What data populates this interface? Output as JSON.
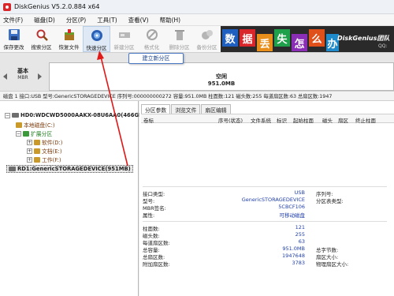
{
  "window": {
    "title": "DiskGenius V5.2.0.884 x64"
  },
  "menu": [
    "文件(F)",
    "磁盘(D)",
    "分区(P)",
    "工具(T)",
    "查看(V)",
    "帮助(H)"
  ],
  "toolbar": [
    {
      "label": "保存更改",
      "icon": "save-icon",
      "state": "normal"
    },
    {
      "label": "搜索分区",
      "icon": "magnifier-icon",
      "state": "normal"
    },
    {
      "label": "恢复文件",
      "icon": "recover-icon",
      "state": "normal"
    },
    {
      "label": "快速分区",
      "icon": "disc-icon",
      "state": "active"
    },
    {
      "label": "新建分区",
      "icon": "new-partition-icon",
      "state": "disabled"
    },
    {
      "label": "格式化",
      "icon": "format-icon",
      "state": "disabled"
    },
    {
      "label": "删除分区",
      "icon": "delete-icon",
      "state": "disabled"
    },
    {
      "label": "备份分区",
      "icon": "backup-icon",
      "state": "disabled"
    }
  ],
  "banner": {
    "tiles": [
      "数",
      "据",
      "丢",
      "失",
      "怎",
      "么",
      "办"
    ],
    "brand": "DiskGenius团队",
    "url": "QQ:"
  },
  "disk_view": {
    "left_label": "基本",
    "left_sub": "MBR",
    "partition_label": "空闲",
    "partition_size": "951.0MB",
    "tooltip": "建立新分区"
  },
  "info_bar": "磁盘 1 接口:USB 型号:GenericSTORAGEDEVICE 序列号:000000000272 容量:951.0MB 柱面数:121 磁头数:255 每道扇区数:63 总扇区数:1947",
  "tree": {
    "hd0": "HD0:WDCWD5000AAKX-08U6AA0(466GB)",
    "local_disk": "本地磁盘(C:)",
    "extended": "扩展分区",
    "software": "软件(D:)",
    "documents": "文档(E:)",
    "work": "工作(F:)",
    "rd1": "RD1:GenericSTORAGEDEVICE(951MB)"
  },
  "tabs": [
    "分区参数",
    "浏览文件",
    "扇区编辑"
  ],
  "columns": [
    "卷标",
    "序号(状态)",
    "文件系统",
    "标识",
    "起始柱面",
    "磁头",
    "扇区",
    "终止柱面"
  ],
  "props_block1": [
    {
      "key": "接口类型:",
      "value": "USB",
      "key2": "序列号:"
    },
    {
      "key": "型号:",
      "value": "GenericSTORAGEDEVICE",
      "key2": "分区表类型:"
    },
    {
      "key": "MBR签名:",
      "value": "5CBCF106",
      "key2": ""
    },
    {
      "key": "属性:",
      "value": "可移动磁盘",
      "key2": ""
    }
  ],
  "props_block2": [
    {
      "key": "柱面数:",
      "value": "121",
      "key2": ""
    },
    {
      "key": "磁头数:",
      "value": "255",
      "key2": ""
    },
    {
      "key": "每道扇区数:",
      "value": "63",
      "key2": ""
    },
    {
      "key": "总容量:",
      "value": "951.0MB",
      "key2": "总字节数:"
    },
    {
      "key": "总扇区数:",
      "value": "1947648",
      "key2": "扇区大小:"
    },
    {
      "key": "附加扇区数:",
      "value": "3783",
      "key2": "物理扇区大小:"
    }
  ],
  "colors": {
    "accent_red": "#d8262a",
    "tree_blue": "#1f3ea8",
    "tree_green": "#1e7c1e",
    "tile_colors": [
      "#1f5fbf",
      "#d8262a",
      "#e88e1a",
      "#1fa04a",
      "#8a2fb5",
      "#e0501a",
      "#1f8ac9"
    ]
  }
}
